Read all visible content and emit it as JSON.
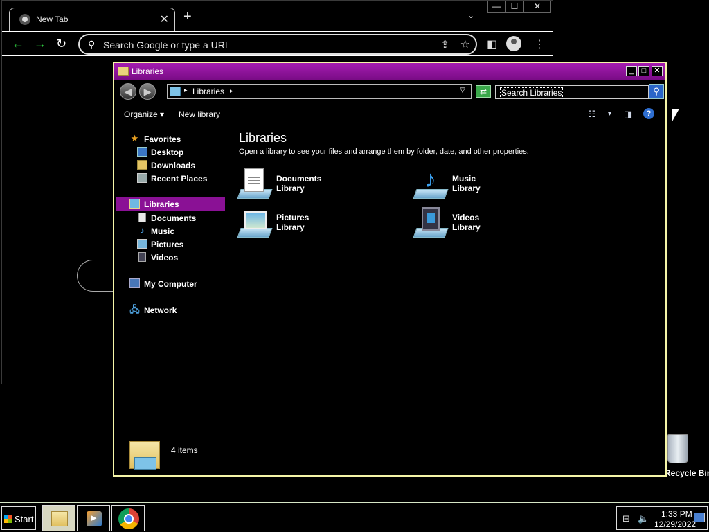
{
  "chrome": {
    "tab_title": "New Tab",
    "tab_close": "✕",
    "new_tab": "+",
    "tab_search": "⌄",
    "minimize": "—",
    "maximize": "☐",
    "close": "✕",
    "back": "←",
    "forward": "→",
    "reload": "↻",
    "omnibox_placeholder": "Search Google or type a URL",
    "search_icon": "⚲",
    "share_icon": "⇪",
    "star_icon": "☆",
    "sidepanel_icon": "◧",
    "menu_icon": "⋮"
  },
  "explorer": {
    "title": "Libraries",
    "min": "_",
    "max": "□",
    "close": "✕",
    "nav_back": "◀",
    "nav_forward": "▶",
    "address_arrow": "▸",
    "address": "Libraries",
    "address_drop": "▽",
    "refresh": "⇄",
    "search_placeholder": "Search Libraries",
    "search_button": "⚲",
    "commands": {
      "organize": "Organize ▾",
      "new_library": "New library",
      "view_icon": "☷",
      "view_arrow": "▾",
      "preview_icon": "◨",
      "help": "?"
    },
    "nav_pane": {
      "favorites": "Favorites",
      "desktop": "Desktop",
      "downloads": "Downloads",
      "recent_places": "Recent Places",
      "libraries": "Libraries",
      "documents": "Documents",
      "music": "Music",
      "pictures": "Pictures",
      "videos": "Videos",
      "my_computer": "My Computer",
      "network": "Network"
    },
    "content": {
      "title": "Libraries",
      "subtitle": "Open a library to see your files and arrange them by folder, date, and other properties.",
      "libraries": [
        {
          "name": "Documents",
          "sub": "Library"
        },
        {
          "name": "Music",
          "sub": "Library"
        },
        {
          "name": "Pictures",
          "sub": "Library"
        },
        {
          "name": "Videos",
          "sub": "Library"
        }
      ]
    },
    "status": {
      "item_count": "4 items"
    }
  },
  "desktop": {
    "recycle_bin": "Recycle Bin"
  },
  "taskbar": {
    "start": "Start",
    "time": "1:33 PM",
    "date": "12/29/2022",
    "network_icon": "⊟",
    "volume_icon": "🔈"
  },
  "colors": {
    "explorer_title": "#8a1195",
    "explorer_border": "#f5f5a8",
    "selected_nav": "#8a1195",
    "chrome_nav_green": "#2ecc40"
  }
}
